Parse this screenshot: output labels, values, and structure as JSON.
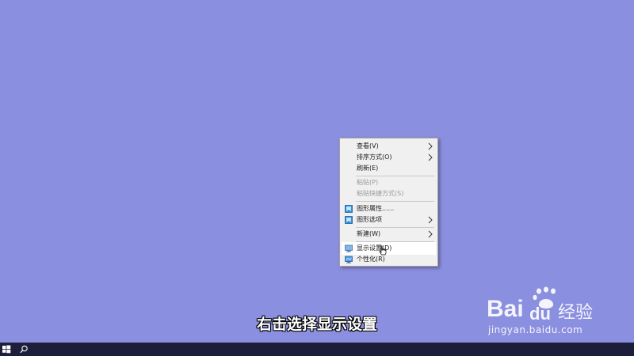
{
  "desktop": {
    "background_color": "#8b8fdf"
  },
  "context_menu": {
    "items": [
      {
        "label": "查看(V)",
        "submenu": true,
        "disabled": false
      },
      {
        "label": "排序方式(O)",
        "submenu": true,
        "disabled": false
      },
      {
        "label": "刷新(E)",
        "submenu": false,
        "disabled": false
      },
      {
        "label": "粘贴(P)",
        "submenu": false,
        "disabled": true
      },
      {
        "label": "粘贴快捷方式(S)",
        "submenu": false,
        "disabled": true
      },
      {
        "label": "图形属性......",
        "submenu": false,
        "disabled": false,
        "icon": "graphics-properties-icon"
      },
      {
        "label": "图形选项",
        "submenu": true,
        "disabled": false,
        "icon": "graphics-options-icon"
      },
      {
        "label": "新建(W)",
        "submenu": true,
        "disabled": false
      },
      {
        "label": "显示设置(D)",
        "submenu": false,
        "disabled": false,
        "icon": "display-settings-icon",
        "highlighted": true
      },
      {
        "label": "个性化(R)",
        "submenu": false,
        "disabled": false,
        "icon": "personalize-icon"
      }
    ]
  },
  "caption": {
    "text": "右击选择显示设置"
  },
  "watermark": {
    "brand": "Baidu经验",
    "url": "jingyan.baidu.com"
  },
  "taskbar": {
    "start_icon": "windows-start-icon",
    "search_icon": "search-icon",
    "color": "#1d1e3a"
  }
}
